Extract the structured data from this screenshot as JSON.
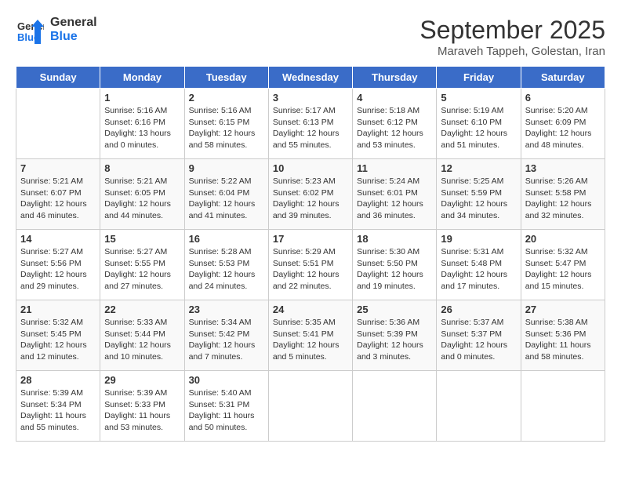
{
  "header": {
    "logo_line1": "General",
    "logo_line2": "Blue",
    "month": "September 2025",
    "location": "Maraveh Tappeh, Golestan, Iran"
  },
  "days_of_week": [
    "Sunday",
    "Monday",
    "Tuesday",
    "Wednesday",
    "Thursday",
    "Friday",
    "Saturday"
  ],
  "weeks": [
    [
      {
        "num": "",
        "info": ""
      },
      {
        "num": "1",
        "info": "Sunrise: 5:16 AM\nSunset: 6:16 PM\nDaylight: 13 hours\nand 0 minutes."
      },
      {
        "num": "2",
        "info": "Sunrise: 5:16 AM\nSunset: 6:15 PM\nDaylight: 12 hours\nand 58 minutes."
      },
      {
        "num": "3",
        "info": "Sunrise: 5:17 AM\nSunset: 6:13 PM\nDaylight: 12 hours\nand 55 minutes."
      },
      {
        "num": "4",
        "info": "Sunrise: 5:18 AM\nSunset: 6:12 PM\nDaylight: 12 hours\nand 53 minutes."
      },
      {
        "num": "5",
        "info": "Sunrise: 5:19 AM\nSunset: 6:10 PM\nDaylight: 12 hours\nand 51 minutes."
      },
      {
        "num": "6",
        "info": "Sunrise: 5:20 AM\nSunset: 6:09 PM\nDaylight: 12 hours\nand 48 minutes."
      }
    ],
    [
      {
        "num": "7",
        "info": "Sunrise: 5:21 AM\nSunset: 6:07 PM\nDaylight: 12 hours\nand 46 minutes."
      },
      {
        "num": "8",
        "info": "Sunrise: 5:21 AM\nSunset: 6:05 PM\nDaylight: 12 hours\nand 44 minutes."
      },
      {
        "num": "9",
        "info": "Sunrise: 5:22 AM\nSunset: 6:04 PM\nDaylight: 12 hours\nand 41 minutes."
      },
      {
        "num": "10",
        "info": "Sunrise: 5:23 AM\nSunset: 6:02 PM\nDaylight: 12 hours\nand 39 minutes."
      },
      {
        "num": "11",
        "info": "Sunrise: 5:24 AM\nSunset: 6:01 PM\nDaylight: 12 hours\nand 36 minutes."
      },
      {
        "num": "12",
        "info": "Sunrise: 5:25 AM\nSunset: 5:59 PM\nDaylight: 12 hours\nand 34 minutes."
      },
      {
        "num": "13",
        "info": "Sunrise: 5:26 AM\nSunset: 5:58 PM\nDaylight: 12 hours\nand 32 minutes."
      }
    ],
    [
      {
        "num": "14",
        "info": "Sunrise: 5:27 AM\nSunset: 5:56 PM\nDaylight: 12 hours\nand 29 minutes."
      },
      {
        "num": "15",
        "info": "Sunrise: 5:27 AM\nSunset: 5:55 PM\nDaylight: 12 hours\nand 27 minutes."
      },
      {
        "num": "16",
        "info": "Sunrise: 5:28 AM\nSunset: 5:53 PM\nDaylight: 12 hours\nand 24 minutes."
      },
      {
        "num": "17",
        "info": "Sunrise: 5:29 AM\nSunset: 5:51 PM\nDaylight: 12 hours\nand 22 minutes."
      },
      {
        "num": "18",
        "info": "Sunrise: 5:30 AM\nSunset: 5:50 PM\nDaylight: 12 hours\nand 19 minutes."
      },
      {
        "num": "19",
        "info": "Sunrise: 5:31 AM\nSunset: 5:48 PM\nDaylight: 12 hours\nand 17 minutes."
      },
      {
        "num": "20",
        "info": "Sunrise: 5:32 AM\nSunset: 5:47 PM\nDaylight: 12 hours\nand 15 minutes."
      }
    ],
    [
      {
        "num": "21",
        "info": "Sunrise: 5:32 AM\nSunset: 5:45 PM\nDaylight: 12 hours\nand 12 minutes."
      },
      {
        "num": "22",
        "info": "Sunrise: 5:33 AM\nSunset: 5:44 PM\nDaylight: 12 hours\nand 10 minutes."
      },
      {
        "num": "23",
        "info": "Sunrise: 5:34 AM\nSunset: 5:42 PM\nDaylight: 12 hours\nand 7 minutes."
      },
      {
        "num": "24",
        "info": "Sunrise: 5:35 AM\nSunset: 5:41 PM\nDaylight: 12 hours\nand 5 minutes."
      },
      {
        "num": "25",
        "info": "Sunrise: 5:36 AM\nSunset: 5:39 PM\nDaylight: 12 hours\nand 3 minutes."
      },
      {
        "num": "26",
        "info": "Sunrise: 5:37 AM\nSunset: 5:37 PM\nDaylight: 12 hours\nand 0 minutes."
      },
      {
        "num": "27",
        "info": "Sunrise: 5:38 AM\nSunset: 5:36 PM\nDaylight: 11 hours\nand 58 minutes."
      }
    ],
    [
      {
        "num": "28",
        "info": "Sunrise: 5:39 AM\nSunset: 5:34 PM\nDaylight: 11 hours\nand 55 minutes."
      },
      {
        "num": "29",
        "info": "Sunrise: 5:39 AM\nSunset: 5:33 PM\nDaylight: 11 hours\nand 53 minutes."
      },
      {
        "num": "30",
        "info": "Sunrise: 5:40 AM\nSunset: 5:31 PM\nDaylight: 11 hours\nand 50 minutes."
      },
      {
        "num": "",
        "info": ""
      },
      {
        "num": "",
        "info": ""
      },
      {
        "num": "",
        "info": ""
      },
      {
        "num": "",
        "info": ""
      }
    ]
  ]
}
